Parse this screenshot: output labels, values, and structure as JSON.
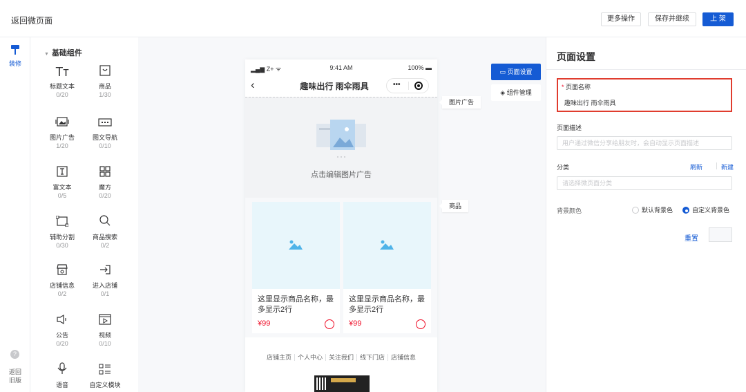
{
  "topbar": {
    "back": "返回微页面",
    "more": "更多操作",
    "save_continue": "保存并继续",
    "publish": "上 架"
  },
  "rail": {
    "decorate": "装修",
    "old_version_line1": "返回",
    "old_version_line2": "旧版"
  },
  "components": {
    "group": "基础组件",
    "items": [
      {
        "label": "标题文本",
        "count": "0/20",
        "icon": "title-text-icon"
      },
      {
        "label": "商品",
        "count": "1/30",
        "icon": "goods-icon"
      },
      {
        "label": "图片广告",
        "count": "1/20",
        "icon": "image-ad-icon"
      },
      {
        "label": "图文导航",
        "count": "0/10",
        "icon": "image-nav-icon"
      },
      {
        "label": "富文本",
        "count": "0/5",
        "icon": "rich-text-icon"
      },
      {
        "label": "魔方",
        "count": "0/20",
        "icon": "cube-icon"
      },
      {
        "label": "辅助分割",
        "count": "0/30",
        "icon": "divider-icon"
      },
      {
        "label": "商品搜索",
        "count": "0/2",
        "icon": "search-icon"
      },
      {
        "label": "店铺信息",
        "count": "0/2",
        "icon": "store-info-icon"
      },
      {
        "label": "进入店铺",
        "count": "0/1",
        "icon": "enter-store-icon"
      },
      {
        "label": "公告",
        "count": "0/20",
        "icon": "notice-icon"
      },
      {
        "label": "视频",
        "count": "0/10",
        "icon": "video-icon"
      },
      {
        "label": "语音",
        "count": "",
        "icon": "voice-icon"
      },
      {
        "label": "自定义模块",
        "count": "",
        "icon": "custom-module-icon"
      }
    ]
  },
  "phone": {
    "carrier": "Z+",
    "time": "9:41 AM",
    "battery": "100%",
    "title": "趣味出行 雨伞雨具",
    "banner_text": "点击编辑图片广告",
    "goods": [
      {
        "name": "这里显示商品名称，最多显示2行",
        "price": "¥99"
      },
      {
        "name": "这里显示商品名称，最多显示2行",
        "price": "¥99"
      }
    ],
    "footer_links": [
      "店铺主页",
      "个人中心",
      "关注我们",
      "线下门店",
      "店铺信息"
    ]
  },
  "tags": {
    "image_ad": "图片广告",
    "goods": "商品"
  },
  "side_tabs": {
    "page_settings": "页面设置",
    "component_mgmt": "组件管理"
  },
  "settings": {
    "title": "页面设置",
    "name_label": "页面名称",
    "name_value": "趣味出行 雨伞雨具",
    "desc_label": "页面描述",
    "desc_placeholder": "用户通过微信分享给朋友时，会自动显示页面描述",
    "category_label": "分类",
    "refresh": "刷新",
    "new": "新建",
    "category_placeholder": "请选择微页面分类",
    "bg_label": "背景颜色",
    "bg_default": "默认背景色",
    "bg_custom": "自定义背景色",
    "bg_selected": "自定义背景色",
    "reset": "重置"
  },
  "colors": {
    "primary": "#155bd4",
    "price": "#ee0a24",
    "highlight": "#e03c2e"
  }
}
